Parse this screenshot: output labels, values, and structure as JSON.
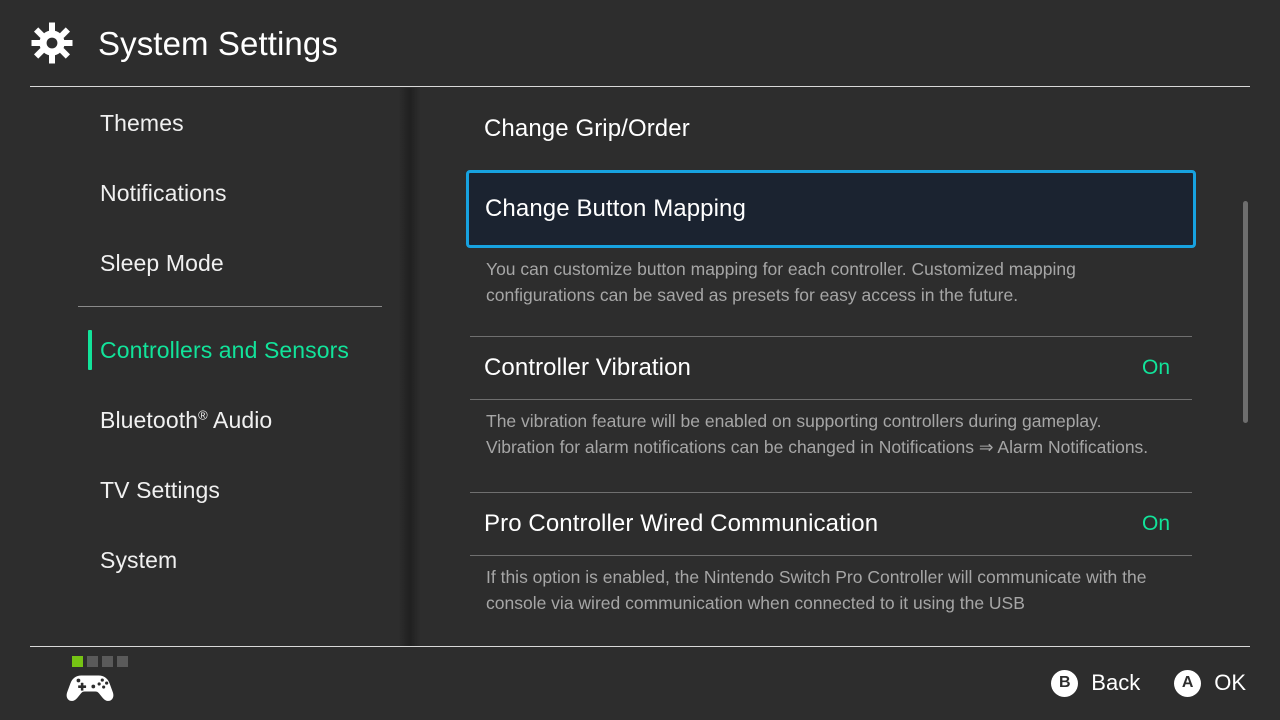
{
  "header": {
    "title": "System Settings",
    "icon": "gear-icon"
  },
  "sidebar": {
    "items": [
      {
        "label": "Themes",
        "active": false,
        "separator_after": false
      },
      {
        "label": "Notifications",
        "active": false,
        "separator_after": false
      },
      {
        "label": "Sleep Mode",
        "active": false,
        "separator_after": true
      },
      {
        "label": "Controllers and Sensors",
        "active": true,
        "separator_after": false
      },
      {
        "label": "Bluetooth® Audio",
        "active": false,
        "separator_after": false
      },
      {
        "label": "TV Settings",
        "active": false,
        "separator_after": false
      },
      {
        "label": "System",
        "active": false,
        "separator_after": false
      }
    ],
    "active_label": "Controllers and Sensors",
    "accent_color": "#12e39a"
  },
  "content": {
    "rows": [
      {
        "label": "Change Grip/Order",
        "value": "",
        "selected": false,
        "description": ""
      },
      {
        "label": "Change Button Mapping",
        "value": "",
        "selected": true,
        "description": "You can customize button mapping for each controller. Customized mapping configurations can be saved as presets for easy access in the future."
      },
      {
        "label": "Controller Vibration",
        "value": "On",
        "selected": false,
        "description": "The vibration feature will be enabled on supporting controllers during gameplay. Vibration for alarm notifications can be changed in Notifications ⇒ Alarm Notifications."
      },
      {
        "label": "Pro Controller Wired Communication",
        "value": "On",
        "selected": false,
        "description": "If this option is enabled, the Nintendo Switch Pro Controller will communicate with the console via wired communication when connected to it using the USB"
      }
    ],
    "selection_border_color": "#17a2e0",
    "selection_fill_color": "#1b2330",
    "value_color": "#12e39a"
  },
  "footer": {
    "player_leds": [
      true,
      false,
      false,
      false
    ],
    "controller_icon": "gamepad-icon",
    "hints": [
      {
        "glyph": "B",
        "label": "Back"
      },
      {
        "glyph": "A",
        "label": "OK"
      }
    ]
  }
}
